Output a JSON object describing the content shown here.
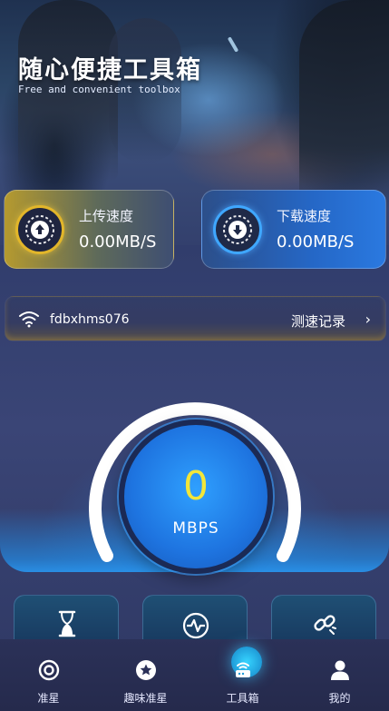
{
  "hero": {
    "title": "随心便捷工具箱",
    "subtitle": "Free and convenient toolbox"
  },
  "speed": {
    "upload": {
      "label": "上传速度",
      "value": "0.00MB/S",
      "icon": "upload-gauge-icon",
      "accent": "#e2b62a"
    },
    "download": {
      "label": "下载速度",
      "value": "0.00MB/S",
      "icon": "download-gauge-icon",
      "accent": "#3fa7ff"
    }
  },
  "wifi": {
    "network_name": "fdbxhms076",
    "record_label": "测速记录",
    "chevron": "›"
  },
  "gauge": {
    "value": "0",
    "unit": "MBPS",
    "value_color": "#f2e63a"
  },
  "tools": [
    {
      "icon": "hourglass-icon"
    },
    {
      "icon": "pulse-monitor-icon"
    },
    {
      "icon": "link-icon"
    }
  ],
  "nav": {
    "items": [
      {
        "label": "准星",
        "icon": "crosshair-icon",
        "active": false
      },
      {
        "label": "趣味准星",
        "icon": "star-icon",
        "active": false
      },
      {
        "label": "工具箱",
        "icon": "toolbox-router-icon",
        "active": true
      },
      {
        "label": "我的",
        "icon": "profile-icon",
        "active": false
      }
    ]
  }
}
